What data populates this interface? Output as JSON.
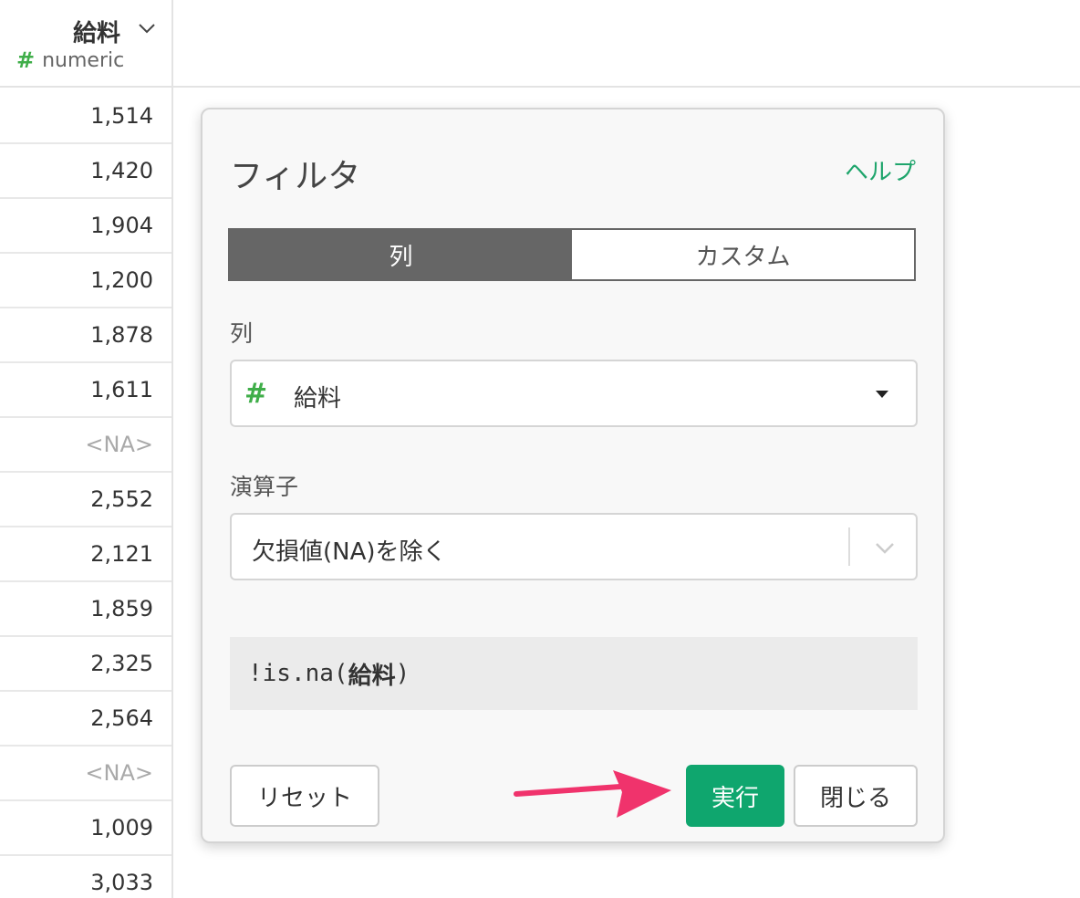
{
  "column": {
    "name": "給料",
    "type_label": "numeric",
    "type_icon": "#",
    "rows": [
      "1,514",
      "1,420",
      "1,904",
      "1,200",
      "1,878",
      "1,611",
      "<NA>",
      "2,552",
      "2,121",
      "1,859",
      "2,325",
      "2,564",
      "<NA>",
      "1,009",
      "3,033"
    ]
  },
  "dialog": {
    "title": "フィルタ",
    "help": "ヘルプ",
    "tabs": [
      {
        "label": "列",
        "active": true
      },
      {
        "label": "カスタム",
        "active": false
      }
    ],
    "column_field": {
      "label": "列",
      "icon": "#",
      "value": "給料"
    },
    "operator_field": {
      "label": "演算子",
      "value": "欠損値(NA)を除く"
    },
    "expression": {
      "prefix": "!is.na(",
      "column": "給料",
      "suffix": ")"
    },
    "buttons": {
      "reset": "リセット",
      "run": "実行",
      "close": "閉じる"
    }
  },
  "colors": {
    "accent_green": "#0fa66e",
    "numeric_icon_green": "#3fae49",
    "help_link": "#1fa56c",
    "active_tab": "#666666",
    "arrow_pink": "#f0336c",
    "na_text": "#a9a9a9"
  }
}
